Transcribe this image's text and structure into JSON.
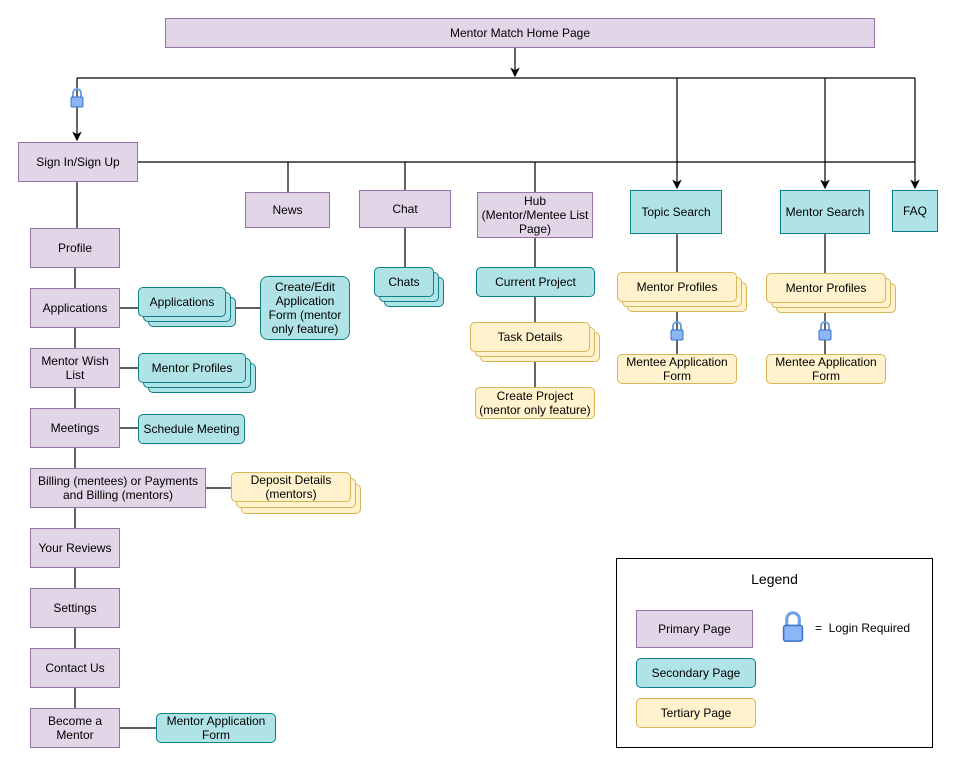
{
  "colors": {
    "primary": "#e1d5e7",
    "secondary": "#b0e3e6",
    "tertiary": "#fff2cc"
  },
  "nodes": {
    "home": "Mentor Match Home Page",
    "signin": "Sign In/Sign Up",
    "news": "News",
    "chat": "Chat",
    "hub": "Hub (Mentor/Mentee List Page)",
    "topic": "Topic Search",
    "mentorsearch": "Mentor Search",
    "faq": "FAQ",
    "profile": "Profile",
    "applications": "Applications",
    "wishlist": "Mentor Wish List",
    "meetings": "Meetings",
    "billing": "Billing (mentees) or Payments and Billing (mentors)",
    "reviews": "Your Reviews",
    "settings": "Settings",
    "contact": "Contact Us",
    "become": "Become a Mentor",
    "apps_stack": "Applications",
    "create_edit": "Create/Edit Application Form (mentor only feature)",
    "wish_profiles": "Mentor Profiles",
    "schedule": "Schedule Meeting",
    "deposit": "Deposit Details (mentors)",
    "mentor_app_form": "Mentor Application Form",
    "chats": "Chats",
    "current_project": "Current Project",
    "task_details": "Task Details",
    "create_project": "Create Project (mentor only feature)",
    "topic_profiles": "Mentor Profiles",
    "topic_form": "Mentee Application Form",
    "ms_profiles": "Mentor Profiles",
    "ms_form": "Mentee Application Form"
  },
  "legend": {
    "title": "Legend",
    "primary": "Primary Page",
    "secondary": "Secondary Page",
    "tertiary": "Tertiary Page",
    "lock_label": "=  Login Required",
    "lock_icon": "lock-icon"
  }
}
